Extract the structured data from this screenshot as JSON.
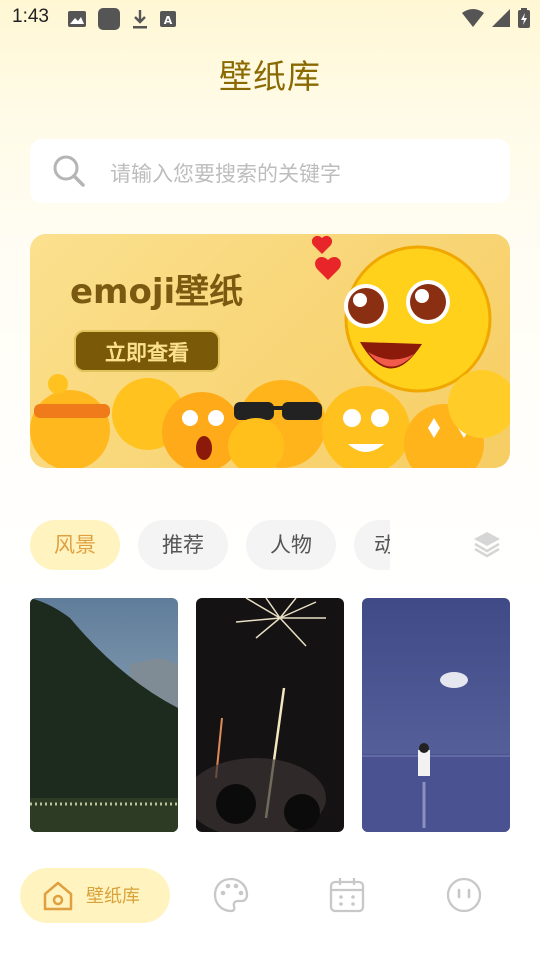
{
  "status_bar": {
    "time": "1:43"
  },
  "page": {
    "title": "壁纸库"
  },
  "search": {
    "placeholder": "请输入您要搜索的关键字"
  },
  "banner": {
    "title": "emoji壁纸",
    "button_label": "立即查看"
  },
  "categories": [
    {
      "label": "风景",
      "active": true
    },
    {
      "label": "推荐",
      "active": false
    },
    {
      "label": "人物",
      "active": false
    },
    {
      "label": "动",
      "active": false
    }
  ],
  "wallpapers": [
    {
      "name": "mountain-forest"
    },
    {
      "name": "fireworks-night"
    },
    {
      "name": "sea-figure"
    }
  ],
  "bottom_nav": {
    "home_label": "壁纸库"
  },
  "colors": {
    "accent": "#d9a23a",
    "title": "#8a6a00",
    "active_tab_bg": "#fff3c0"
  }
}
